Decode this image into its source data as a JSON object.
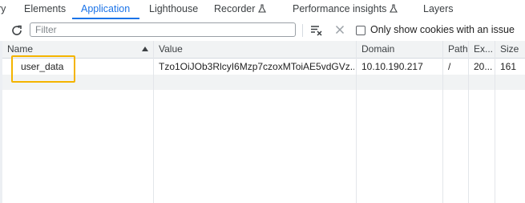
{
  "tabs": [
    {
      "label": "ry",
      "active": false
    },
    {
      "label": "Elements",
      "active": false
    },
    {
      "label": "Application",
      "active": true
    },
    {
      "label": "Lighthouse",
      "active": false
    },
    {
      "label": "Recorder",
      "active": false,
      "icon": "flask-icon"
    },
    {
      "label": "Performance insights",
      "active": false,
      "icon": "flask-icon"
    },
    {
      "label": "Layers",
      "active": false
    }
  ],
  "toolbar": {
    "refresh_icon": "refresh-icon",
    "filter_placeholder": "Filter",
    "clear_filter_icon": "clear-filter-icon",
    "close_icon": "close-icon",
    "checkbox_label": "Only show cookies with an issue",
    "checkbox_checked": false
  },
  "table": {
    "columns": [
      "Name",
      "Value",
      "Domain",
      "Path",
      "Ex...",
      "Size"
    ],
    "sorted_column": "Name",
    "rows": [
      {
        "name": "user_data",
        "value": "Tzo1OiJOb3RlcyI6Mzp7czoxMToiAE5vdGVz...",
        "domain": "10.10.190.217",
        "path": "/",
        "expires": "20...",
        "size": "161"
      }
    ]
  },
  "colors": {
    "accent": "#1a73e8",
    "highlight": "#f4b400",
    "header_bg": "#f1f3f4",
    "border": "#d6dbe1"
  }
}
